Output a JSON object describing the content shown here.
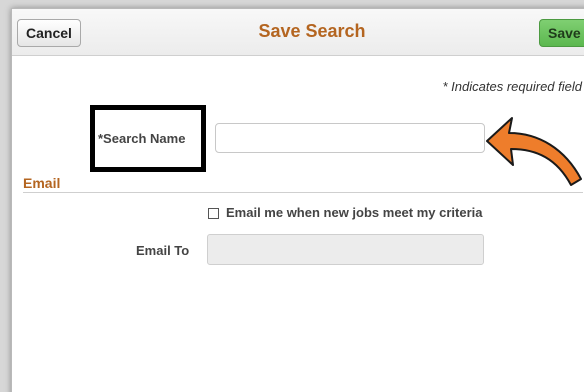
{
  "header": {
    "cancel_label": "Cancel",
    "title": "Save Search",
    "save_label": "Save"
  },
  "form": {
    "required_note": "* Indicates required field",
    "search_name_label": "*Search Name",
    "search_name_value": "",
    "email_section_title": "Email",
    "email_checkbox_label": "Email me when new jobs meet my criteria",
    "email_checkbox_checked": false,
    "email_to_label": "Email To",
    "email_to_value": ""
  },
  "annotations": {
    "arrow_icon": "curved-arrow-icon",
    "arrow_color": "#ee7d2b",
    "highlight_color": "#000000"
  },
  "colors": {
    "accent": "#b46520",
    "save_button": "#5cb84f"
  }
}
